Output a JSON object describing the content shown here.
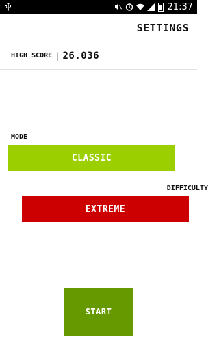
{
  "status_bar": {
    "icons": [
      "usb-icon",
      "mute-icon",
      "alarm-icon",
      "wifi-icon",
      "signal-icon",
      "battery-icon"
    ],
    "time": "21:37"
  },
  "header": {
    "title": "SETTINGS"
  },
  "high_score": {
    "label": "HIGH SCORE",
    "separator": "|",
    "value": "26.036"
  },
  "mode": {
    "label": "MODE",
    "value": "CLASSIC",
    "color": "#9ccf00"
  },
  "difficulty": {
    "label": "DIFFICULTY",
    "value": "EXTREME",
    "color": "#cc0000"
  },
  "start": {
    "label": "START",
    "color": "#669900"
  }
}
